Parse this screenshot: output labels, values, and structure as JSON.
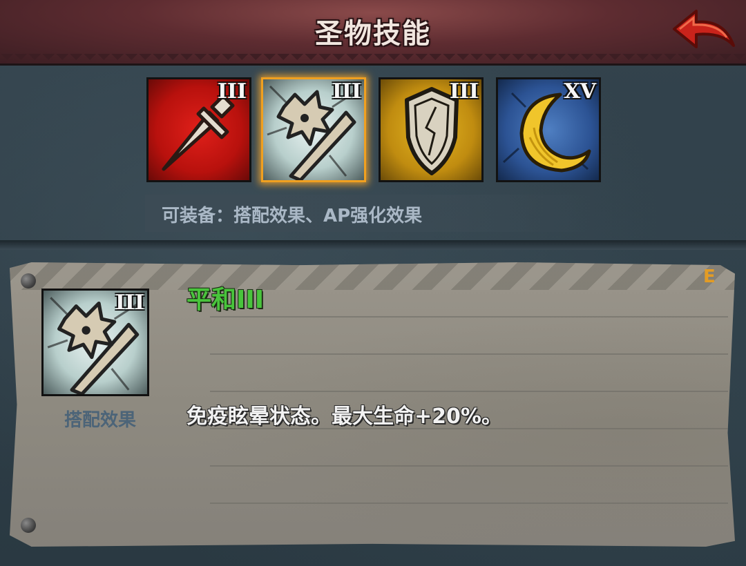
{
  "header": {
    "title": "圣物技能",
    "back_icon": "red-back-arrow-icon"
  },
  "colors": {
    "accent_selected": "#f0a020",
    "skill_name": "#49c43c",
    "grade": "#e39c25"
  },
  "relics": [
    {
      "name": "sword-relic",
      "level": "III",
      "color": "red",
      "icon": "sword-icon"
    },
    {
      "name": "mace-relic",
      "level": "III",
      "color": "white",
      "icon": "spiked-mace-icon",
      "selected": true
    },
    {
      "name": "shield-relic",
      "level": "III",
      "color": "yellow",
      "icon": "shield-icon"
    },
    {
      "name": "moon-relic",
      "level": "XV",
      "color": "blue",
      "icon": "crescent-moon-icon"
    }
  ],
  "equip_info": "可装备：搭配效果、AP强化效果",
  "detail": {
    "icon": "spiked-mace-icon",
    "icon_level": "III",
    "label": "搭配效果",
    "skill_name": "平和III",
    "grade": "E",
    "description": "免疫眩晕状态。最大生命+20%。"
  }
}
